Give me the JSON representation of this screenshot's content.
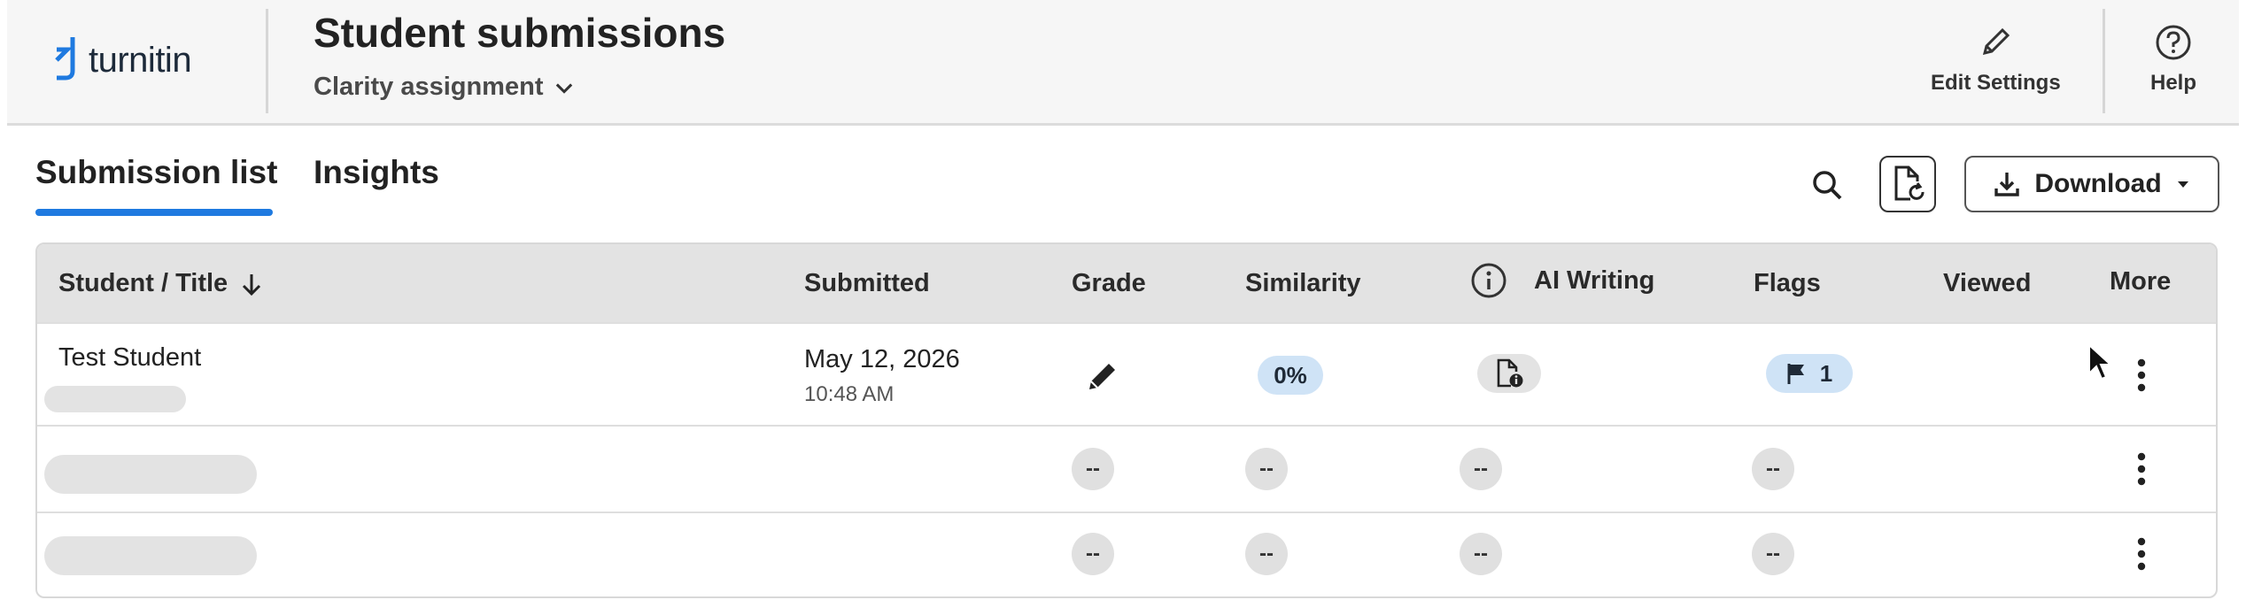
{
  "header": {
    "logo_text": "turnitin",
    "title": "Student submissions",
    "assignment": "Clarity assignment",
    "edit_settings": "Edit Settings",
    "help": "Help"
  },
  "tabs": [
    {
      "label": "Submission list",
      "active": true
    },
    {
      "label": "Insights",
      "active": false
    }
  ],
  "toolbar": {
    "download_label": "Download"
  },
  "table": {
    "columns": {
      "student": "Student / Title",
      "submitted": "Submitted",
      "grade": "Grade",
      "similarity": "Similarity",
      "ai_writing": "AI Writing",
      "flags": "Flags",
      "viewed": "Viewed",
      "more": "More"
    },
    "rows": [
      {
        "student": "Test Student",
        "date": "May 12, 2026",
        "time": "10:48 AM",
        "similarity": "0%",
        "flags": "1"
      },
      {
        "grade": "--",
        "similarity": "--",
        "ai_writing": "--",
        "flags": "--"
      },
      {
        "grade": "--",
        "similarity": "--",
        "ai_writing": "--",
        "flags": "--"
      }
    ]
  },
  "colors": {
    "accent": "#1f7ae0",
    "pill_blue": "#cfe3f6",
    "header_bg": "#f6f6f6",
    "table_header_bg": "#e3e3e3"
  }
}
